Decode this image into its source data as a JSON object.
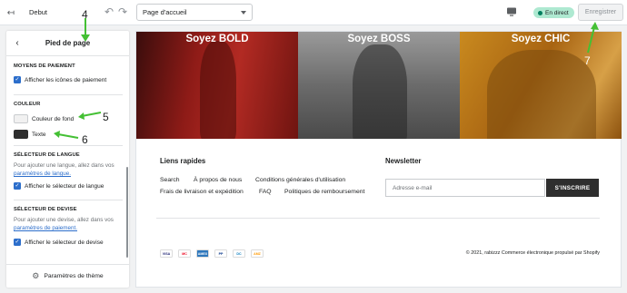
{
  "topbar": {
    "store_name": "Debut",
    "page_select": "Page d'accueil",
    "live_badge": "En direct",
    "save_label": "Enregistrer"
  },
  "sidebar": {
    "title": "Pied de page",
    "sections": {
      "payment": {
        "label": "MOYENS DE PAIEMENT",
        "checkbox_label": "Afficher les icônes de paiement"
      },
      "color": {
        "label": "COULEUR",
        "background_label": "Couleur de fond",
        "text_label": "Texte",
        "background_color": "#f1f1f1",
        "text_color": "#2e2e2e"
      },
      "language": {
        "label": "SÉLECTEUR DE LANGUE",
        "help_prefix": "Pour ajouter une langue, allez dans vos",
        "help_link": "paramètres de langue.",
        "checkbox_label": "Afficher le sélecteur de langue"
      },
      "currency": {
        "label": "SÉLECTEUR DE DEVISE",
        "help_prefix": "Pour ajouter une devise, allez dans vos",
        "help_link": "paramètres de paiement.",
        "checkbox_label": "Afficher le sélecteur de devise"
      }
    },
    "footer_label": "Paramètres de thème"
  },
  "preview": {
    "hero": [
      "Soyez BOLD",
      "Soyez BOSS",
      "Soyez CHIC"
    ],
    "quick_links_title": "Liens rapides",
    "links_row1": [
      "Search",
      "À propos de nous",
      "Conditions générales d'utilisation"
    ],
    "links_row2": [
      "Frais de livraison et expédition",
      "FAQ",
      "Politiques de remboursement"
    ],
    "newsletter_title": "Newsletter",
    "email_placeholder": "Adresse e-mail",
    "subscribe_label": "S'INSCRIRE",
    "payment_icons": [
      "VISA",
      "MC",
      "AMEX",
      "PP",
      "DC",
      "AMZ"
    ],
    "copyright": "© 2021, rabizzz Commerce électronique propulsé par Shopify"
  },
  "annotations": [
    "4",
    "5",
    "6",
    "7"
  ],
  "colors": {
    "accent": "#2c6ecb",
    "annotation_arrow": "#44c034",
    "live_badge_bg": "#aee9d1"
  }
}
